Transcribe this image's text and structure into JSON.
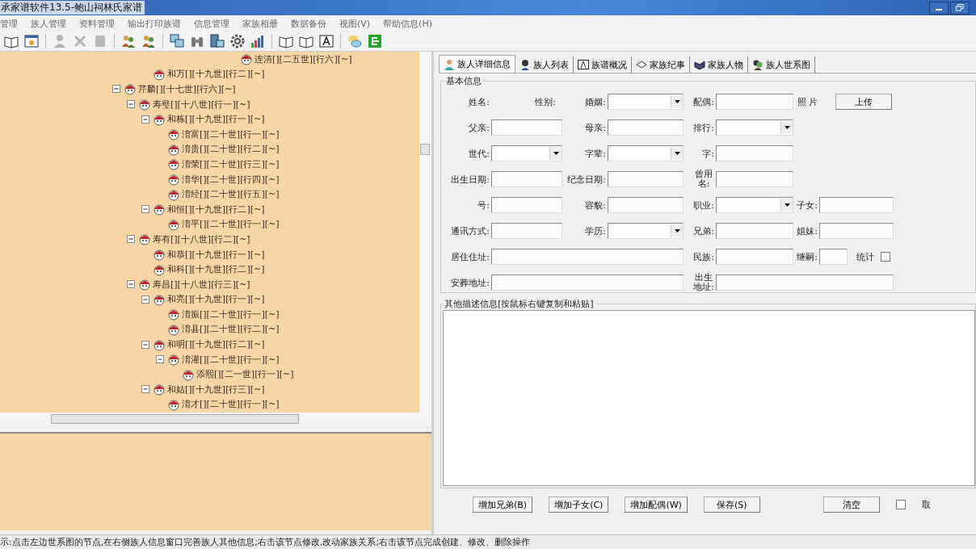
{
  "window": {
    "title": "承家谱软件13.5-鲍山祠林氏家谱"
  },
  "menu": [
    "管理",
    "族人管理",
    "资料管理",
    "输出打印族谱",
    "信息管理",
    "家族相册",
    "数据备份",
    "视图(V)",
    "帮助信息(H)"
  ],
  "toolbar": [
    [
      {
        "disabled": false
      },
      {
        "disabled": false
      }
    ],
    [
      {
        "disabled": true
      },
      {
        "disabled": true
      },
      {
        "disabled": true
      }
    ],
    [
      {
        "disabled": false
      },
      {
        "disabled": false
      }
    ],
    [
      {
        "disabled": false
      },
      {
        "disabled": false
      },
      {
        "disabled": false
      },
      {
        "disabled": false
      },
      {
        "disabled": false
      }
    ],
    [
      {
        "disabled": false
      },
      {
        "disabled": false
      },
      {
        "disabled": false
      }
    ],
    [
      {
        "disabled": false
      },
      {
        "disabled": false
      }
    ]
  ],
  "tree": {
    "continued_nodes": [
      {
        "label": "连清[][二五世][行六][~]"
      },
      {
        "label": "和万[][十九世][行二][~]"
      }
    ],
    "nodes": [
      {
        "label": "芹麟[][十七世][行六][~]",
        "expanded": true,
        "children": [
          {
            "label": "寿璧[][十八世][行一][~]",
            "expanded": true,
            "children": [
              {
                "label": "和栋[][十九世][行一][~]",
                "expanded": true,
                "children": [
                  {
                    "label": "淯富[][二十世][行一][~]"
                  },
                  {
                    "label": "淯贵[][二十世][行二][~]"
                  },
                  {
                    "label": "淯荣[][二十世][行三][~]"
                  },
                  {
                    "label": "淯华[][二十世][行四][~]"
                  },
                  {
                    "label": "淯经[][二十世][行五][~]"
                  }
                ]
              },
              {
                "label": "和恒[][十九世][行二][~]",
                "expanded": true,
                "children": [
                  {
                    "label": "淯平[][二十世][行一][~]"
                  }
                ]
              }
            ]
          },
          {
            "label": "寿有[][十八世][行二][~]",
            "expanded": true,
            "children": [
              {
                "label": "和恭[][十九世][行一][~]"
              },
              {
                "label": "和科[][十九世][行二][~]"
              }
            ]
          },
          {
            "label": "寿昌[][十八世][行三][~]",
            "expanded": true,
            "children": [
              {
                "label": "和亮[][十九世][行一][~]",
                "expanded": true,
                "children": [
                  {
                    "label": "淯振[][二十世][行一][~]"
                  },
                  {
                    "label": "淯县[][二十世][行二][~]"
                  }
                ]
              },
              {
                "label": "和明[][十九世][行二][~]",
                "expanded": true,
                "children": [
                  {
                    "label": "淯灌[][二十世][行一][~]",
                    "expanded": true,
                    "children": [
                      {
                        "label": "添熙[][二一世][行一][~]"
                      }
                    ]
                  }
                ]
              },
              {
                "label": "和姑[][十九世][行三][~]",
                "expanded": true,
                "children": [
                  {
                    "label": "淯才[][二十世][行一][~]"
                  }
                ]
              }
            ]
          }
        ]
      }
    ]
  },
  "tabs": [
    {
      "label": "族人详细信息",
      "selected": true
    },
    {
      "label": "族人列表",
      "selected": false
    },
    {
      "label": "族谱概况",
      "selected": false
    },
    {
      "label": "家族纪事",
      "selected": false
    },
    {
      "label": "家族人物",
      "selected": false
    },
    {
      "label": "族人世系图",
      "selected": false
    }
  ],
  "basic_info": {
    "title": "基本信息",
    "rows": [
      [
        {
          "kind": "pair",
          "label": "姓名:",
          "label2": "性别:"
        },
        {
          "kind": "select",
          "label": "婚姻:"
        },
        {
          "kind": "text",
          "label": "配偶:"
        },
        {
          "kind": "photo",
          "label": "照 片",
          "button": "上传"
        }
      ],
      [
        {
          "kind": "text",
          "label": "父亲:"
        },
        {
          "kind": "text",
          "label": "母亲:"
        },
        {
          "kind": "select",
          "label": "排行:"
        }
      ],
      [
        {
          "kind": "select",
          "label": "世代:"
        },
        {
          "kind": "select",
          "label": "字辈:"
        },
        {
          "kind": "text",
          "label": "字:"
        }
      ],
      [
        {
          "kind": "text",
          "label": "出生日期:"
        },
        {
          "kind": "text",
          "label": "纪念日期:"
        },
        {
          "kind": "text",
          "label": "曾用名:"
        }
      ],
      [
        {
          "kind": "text",
          "label": "号:"
        },
        {
          "kind": "text",
          "label": "容貌:"
        },
        {
          "kind": "select",
          "label": "职业:"
        },
        {
          "kind": "text",
          "label": "子女:"
        }
      ],
      [
        {
          "kind": "text",
          "label": "通讯方式:"
        },
        {
          "kind": "select",
          "label": "学历:"
        },
        {
          "kind": "text",
          "label": "兄弟:"
        },
        {
          "kind": "text",
          "label": "姐妹:"
        }
      ],
      [
        {
          "kind": "text",
          "label": "居住住址:",
          "colspan": 2
        },
        {
          "kind": "text",
          "label": "民族:"
        },
        {
          "kind": "small",
          "label": "继嗣:"
        },
        {
          "kind": "checkbox",
          "label": "统计",
          "checked": false
        }
      ],
      [
        {
          "kind": "text",
          "label": "安葬地址:",
          "colspan": 2
        },
        {
          "kind": "text",
          "label": "出生地址:",
          "colspan": 2
        }
      ]
    ]
  },
  "description": {
    "title": "其他描述信息[按鼠标右键复制和粘贴]"
  },
  "buttons": [
    {
      "kind": "button",
      "label": "增加兄弟(B)"
    },
    {
      "kind": "button",
      "label": "增加子女(C)"
    },
    {
      "kind": "button",
      "label": "增加配偶(W)"
    },
    {
      "kind": "button",
      "label": "保存(S)"
    },
    {
      "kind": "button",
      "label": "清空"
    },
    {
      "kind": "checkbox",
      "label": "取",
      "checked": false
    }
  ],
  "status_bar": "示:点击左边世系图的节点,在右侧族人信息窗口完善族人其他信息;右击该节点修改,改动家族关系;右击该节点完成创建、修改、删除操作"
}
